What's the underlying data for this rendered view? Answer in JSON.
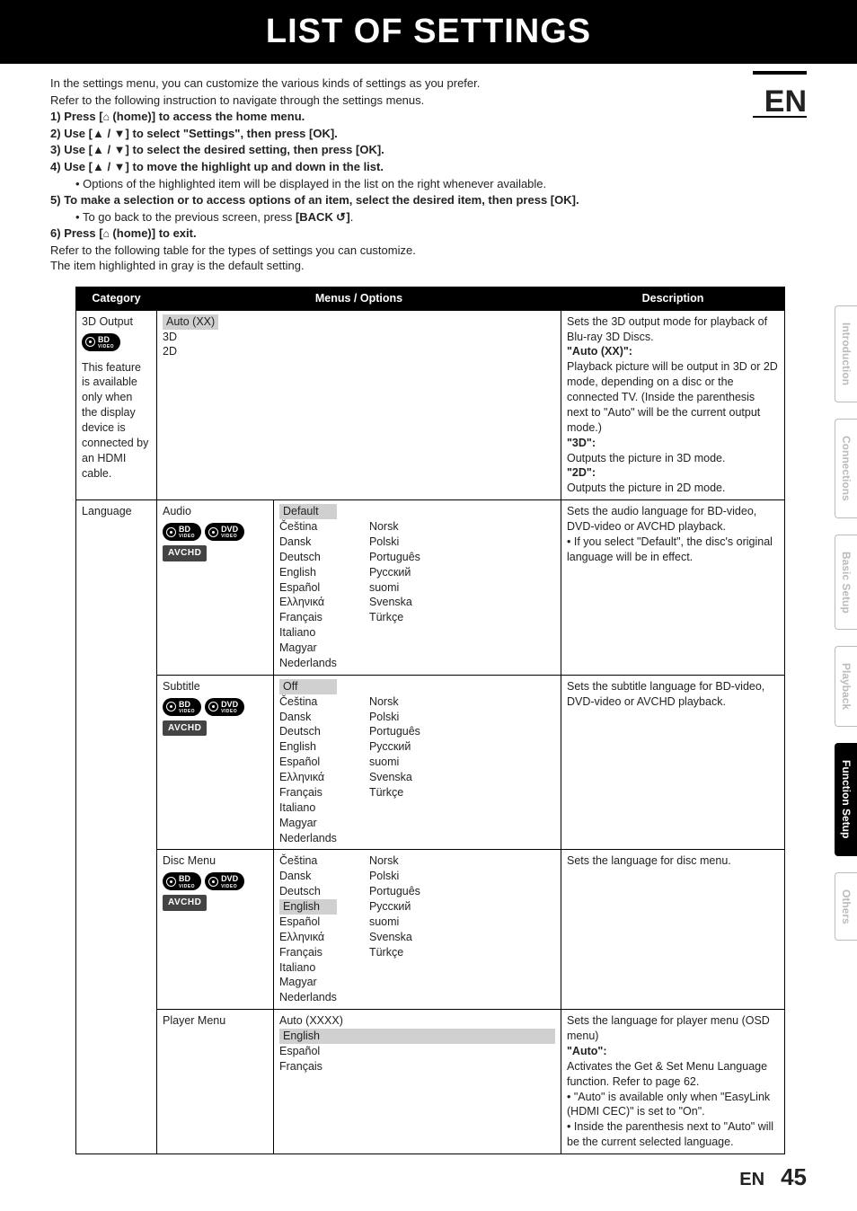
{
  "page_title": "LIST OF SETTINGS",
  "lang_code": "EN",
  "page_number": "45",
  "intro": {
    "l1": "In the settings menu, you can customize the various kinds of settings as you prefer.",
    "l2": "Refer to the following instruction to navigate through the settings menus."
  },
  "steps": {
    "s1n": "1)",
    "s1t": "Press [",
    "s1t2": " (home)] to access the home menu.",
    "s2n": "2)",
    "s2t": "Use [▲ / ▼] to select \"Settings\", then press [OK].",
    "s3n": "3)",
    "s3t": "Use [▲ / ▼] to select the desired setting, then press [OK].",
    "s4n": "4)",
    "s4t": "Use [▲ / ▼] to move the highlight up and down in the list.",
    "s4b": "Options of the highlighted item will be displayed in the list on the right whenever available.",
    "s5n": "5)",
    "s5t": "To make a selection or to access options of an item, select the desired item, then press [OK].",
    "s5b1": "To go back to the previous screen, press ",
    "s5b2": "[BACK ",
    "s5b3": "]",
    "s6n": "6)",
    "s6t": "Press [",
    "s6t2": " (home)] to exit."
  },
  "post_steps": {
    "l1": "Refer to the following table for the types of settings you can customize.",
    "l2": "The item highlighted in gray is the default setting."
  },
  "table_headers": {
    "cat": "Category",
    "menu": "Menus / Options",
    "desc": "Description"
  },
  "badges": {
    "bd": "BD",
    "bd_sub": "VIDEO",
    "dvd": "DVD",
    "dvd_sub": "VIDEO",
    "avchd": "AVCHD"
  },
  "rows": {
    "r1_cat": "3D Output",
    "r1_note": "This feature is available only when the display device is connected by an HDMI cable.",
    "r1_opts": [
      "Auto (XX)",
      "3D",
      "2D"
    ],
    "r1_desc": "Sets the 3D output mode for playback of Blu-ray 3D Discs.",
    "r1_auto_h": "\"Auto (XX)\":",
    "r1_auto_t": "Playback picture will be output in 3D or 2D mode, depending on a disc or the connected TV. (Inside the parenthesis next to \"Auto\" will be the current output mode.)",
    "r1_3d_h": "\"3D\":",
    "r1_3d_t": "Outputs the picture in 3D mode.",
    "r1_2d_h": "\"2D\":",
    "r1_2d_t": "Outputs the picture in 2D mode.",
    "r2_cat": "Language",
    "r2_sub1": "Audio",
    "r2_default": "Default",
    "langs_a": [
      "Čeština",
      "Dansk",
      "Deutsch",
      "English",
      "Español",
      "Ελληνικά",
      "Français",
      "Italiano",
      "Magyar",
      "Nederlands"
    ],
    "langs_b": [
      "Norsk",
      "Polski",
      "Português",
      "Русский",
      "suomi",
      "Svenska",
      "Türkçe"
    ],
    "r2_desc1": "Sets the audio language for BD-video, DVD-video or AVCHD playback.",
    "r2_desc2": "If you select \"Default\", the disc's original language will be in effect.",
    "r3_sub": "Subtitle",
    "r3_off": "Off",
    "r3_desc": "Sets the subtitle language for BD-video, DVD-video or AVCHD playback.",
    "r4_sub": "Disc Menu",
    "r4_default": "English",
    "r4_desc": "Sets the language for disc menu.",
    "r5_sub": "Player Menu",
    "r5_opts_default": "English",
    "r5_opts": [
      "Auto (XXXX)",
      "Español",
      "Français"
    ],
    "r5_desc1": "Sets the language for player menu (OSD menu)",
    "r5_auto_h": "\"Auto\":",
    "r5_auto_t": "Activates the Get & Set Menu Language function. Refer to page 62.",
    "r5_b1": "\"Auto\" is available only when \"EasyLink (HDMI CEC)\" is set to \"On\".",
    "r5_b2": "Inside the parenthesis next to \"Auto\" will be the current selected language."
  },
  "side_tabs": {
    "t1": "Introduction",
    "t2": "Connections",
    "t3": "Basic Setup",
    "t4": "Playback",
    "t5": "Function Setup",
    "t6": "Others"
  }
}
